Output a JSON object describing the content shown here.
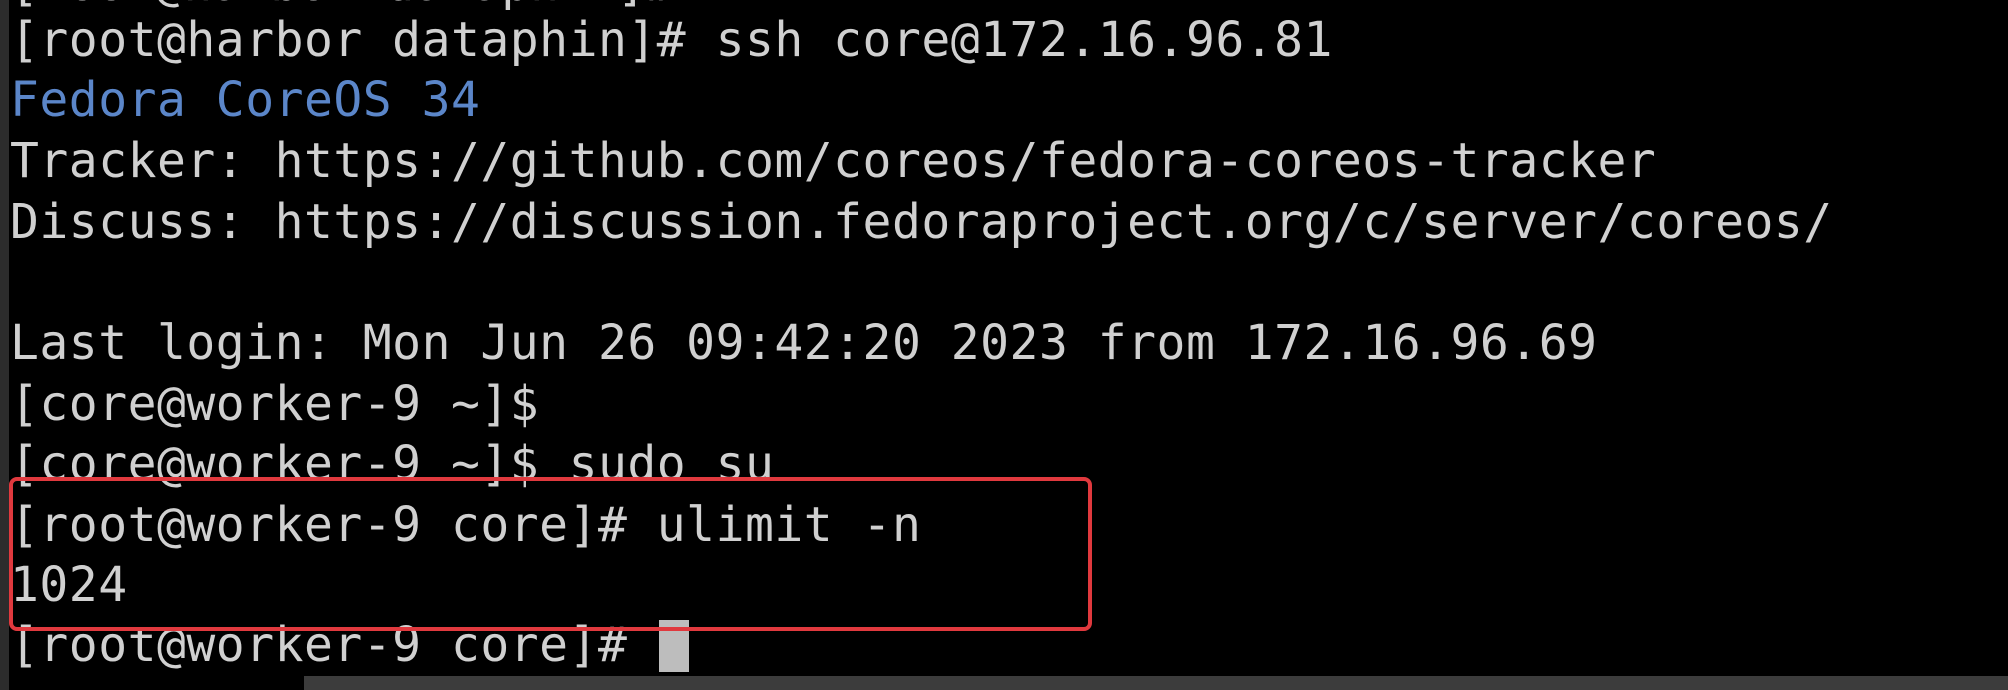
{
  "terminal": {
    "top_partial": "[root@harbor dataphin]#",
    "lines": [
      {
        "text": "[root@harbor dataphin]# ssh core@172.16.96.81",
        "color": "#d0d0d0"
      },
      {
        "text": "Fedora CoreOS 34",
        "color": "#5b86c9"
      },
      {
        "text": "Tracker: https://github.com/coreos/fedora-coreos-tracker",
        "color": "#d0d0d0"
      },
      {
        "text": "Discuss: https://discussion.fedoraproject.org/c/server/coreos/",
        "color": "#d0d0d0"
      },
      {
        "text": "",
        "color": "#d0d0d0"
      },
      {
        "text": "Last login: Mon Jun 26 09:42:20 2023 from 172.16.96.69",
        "color": "#d0d0d0"
      },
      {
        "text": "[core@worker-9 ~]$",
        "color": "#d0d0d0"
      },
      {
        "text": "[core@worker-9 ~]$ sudo su",
        "color": "#d0d0d0"
      },
      {
        "text": "[root@worker-9 core]# ulimit -n",
        "color": "#d0d0d0"
      },
      {
        "text": "1024",
        "color": "#d0d0d0"
      },
      {
        "text": "[root@worker-9 core]# ",
        "color": "#d0d0d0"
      }
    ]
  },
  "colors": {
    "background": "#000000",
    "foreground": "#d0d0d0",
    "banner": "#5b86c9",
    "highlight_border": "#e0393e",
    "cursor": "#bdbdbd"
  }
}
